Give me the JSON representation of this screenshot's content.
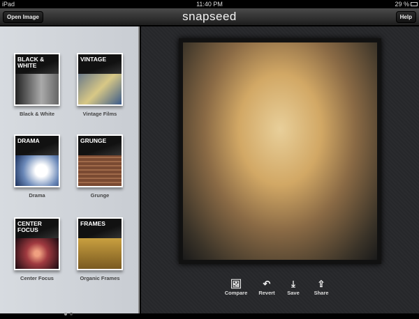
{
  "status": {
    "device": "iPad",
    "time": "11:40 PM",
    "battery": "29 %"
  },
  "nav": {
    "open_image": "Open Image",
    "title": "snapseed",
    "help": "Help"
  },
  "filters": [
    {
      "cover": "BLACK & WHITE",
      "label": "Black & White",
      "img": "linear-gradient(90deg,#222,#aaa 60%,#666)"
    },
    {
      "cover": "VINTAGE",
      "label": "Vintage Films",
      "img": "linear-gradient(135deg,#6b7a8a,#d8c886 50%,#3a5a8a)"
    },
    {
      "cover": "DRAMA",
      "label": "Drama",
      "img": "radial-gradient(circle at 60% 50%,#fff 20%,#6a88b8 60%,#1a2f5a)"
    },
    {
      "cover": "GRUNGE",
      "label": "Grunge",
      "img": "repeating-linear-gradient(0deg,#7a4a32 0 4px,#a06a4a 4px 6px)"
    },
    {
      "cover": "CENTER FOCUS",
      "label": "Center Focus",
      "img": "radial-gradient(circle at 50% 50%,#f0a080 10%,#a03a40 40%,#1a0a10)"
    },
    {
      "cover": "FRAMES",
      "label": "Organic Frames",
      "img": "linear-gradient(180deg,#c9a040,#7a5a20)"
    }
  ],
  "tools": [
    {
      "icon": "image-icon",
      "glyph": "🖼",
      "label": "Compare"
    },
    {
      "icon": "revert-icon",
      "glyph": "↶",
      "label": "Revert"
    },
    {
      "icon": "save-icon",
      "glyph": "⤓",
      "label": "Save"
    },
    {
      "icon": "share-icon",
      "glyph": "⇪",
      "label": "Share"
    }
  ]
}
